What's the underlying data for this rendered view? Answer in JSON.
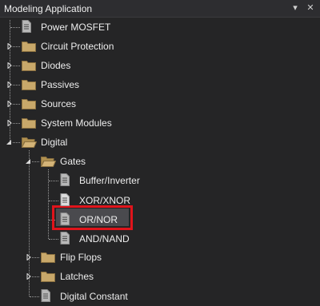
{
  "window": {
    "title": "Modeling Application",
    "dropdown_glyph": "▾",
    "close_glyph": "✕"
  },
  "tree": {
    "items": [
      {
        "label": "Power MOSFET",
        "icon": "document-icon"
      },
      {
        "label": "Circuit Protection",
        "icon": "folder-icon",
        "state": "collapsed"
      },
      {
        "label": "Diodes",
        "icon": "folder-icon",
        "state": "collapsed"
      },
      {
        "label": "Passives",
        "icon": "folder-icon",
        "state": "collapsed"
      },
      {
        "label": "Sources",
        "icon": "folder-icon",
        "state": "collapsed"
      },
      {
        "label": "System Modules",
        "icon": "folder-icon",
        "state": "collapsed"
      },
      {
        "label": "Digital",
        "icon": "open-folder-icon",
        "state": "expanded",
        "children": [
          {
            "label": "Gates",
            "icon": "open-folder-icon",
            "state": "expanded",
            "children": [
              {
                "label": "Buffer/Inverter",
                "icon": "document-icon"
              },
              {
                "label": "XOR/XNOR",
                "icon": "document-icon",
                "selected": true
              },
              {
                "label": "OR/NOR",
                "icon": "document-icon"
              },
              {
                "label": "AND/NAND",
                "icon": "document-icon"
              }
            ]
          },
          {
            "label": "Flip Flops",
            "icon": "folder-icon",
            "state": "collapsed"
          },
          {
            "label": "Latches",
            "icon": "folder-icon",
            "state": "collapsed"
          },
          {
            "label": "Digital Constant",
            "icon": "document-icon"
          }
        ]
      }
    ]
  },
  "colors": {
    "background": "#252526",
    "text": "#ededed",
    "highlight_border": "#e0141b",
    "folder": "#c8a86a"
  }
}
